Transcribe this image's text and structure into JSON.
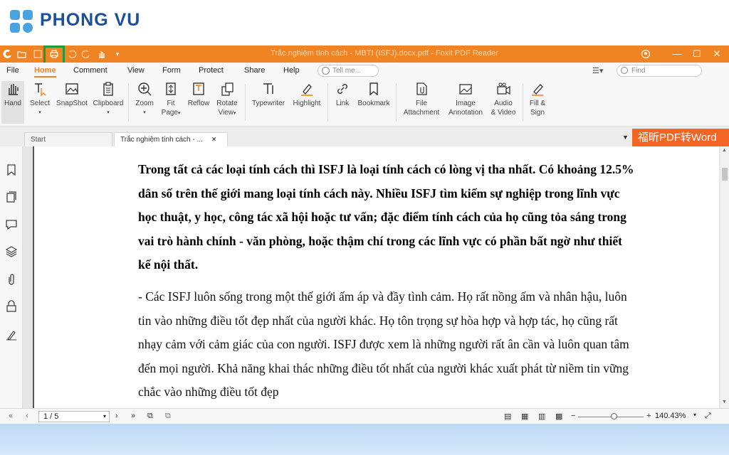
{
  "brand": {
    "name": "PHONG VU",
    "color": "#1b4f9c"
  },
  "window": {
    "title": "Trắc nghiệm tính cách - MBTI (ISFJ).docx.pdf - Foxit PDF Reader",
    "accent": "#f08322"
  },
  "quick_access": [
    "foxit-logo-icon",
    "open-icon",
    "save-icon",
    "print-icon",
    "undo-icon",
    "redo-icon",
    "hand-tool-icon",
    "customize-icon"
  ],
  "menu": {
    "items": [
      "File",
      "Home",
      "Comment",
      "View",
      "Form",
      "Protect",
      "Share",
      "Help"
    ],
    "active": "Home",
    "tell_me": "Tell me...",
    "find": "Find"
  },
  "ribbon": {
    "hand": "Hand",
    "select": "Select",
    "snapshot": "SnapShot",
    "clipboard": "Clipboard",
    "zoom": "Zoom",
    "fit_page_1": "Fit",
    "fit_page_2": "Page",
    "reflow": "Reflow",
    "rotate_view_1": "Rotate",
    "rotate_view_2": "View",
    "typewriter": "Typewriter",
    "highlight": "Highlight",
    "link": "Link",
    "bookmark": "Bookmark",
    "file_attachment_1": "File",
    "file_attachment_2": "Attachment",
    "image_annotation_1": "Image",
    "image_annotation_2": "Annotation",
    "audio_video_1": "Audio",
    "audio_video_2": "& Video",
    "fill_sign_1": "Fill &",
    "fill_sign_2": "Sign"
  },
  "tabs": {
    "start": "Start",
    "document": "Trắc nghiệm tính cách - ...",
    "close": "×"
  },
  "promo": "福昕PDF转Word",
  "document": {
    "bold_paragraph": "Trong tất cả các loại tính cách thì ISFJ là loại tính cách có lòng vị tha nhất. Có khoảng 12.5% dân số trên thế giới mang loại tính cách này. Nhiều ISFJ tìm kiếm sự nghiệp trong lĩnh vực học thuật, y học, công tác xã hội hoặc tư vấn; đặc điểm tính cách của họ cũng tỏa sáng trong vai trò hành chính - văn phòng, hoặc thậm chí trong các lĩnh vực có phần bất ngờ như thiết kế nội thất.",
    "paragraph": "- Các ISFJ luôn sống trong một thế giới ấm áp và đầy tình cảm. Họ rất nồng ấm và nhân hậu, luôn tin vào những điều tốt đẹp nhất của người khác. Họ tôn trọng sự hòa hợp và hợp tác, họ cũng rất nhạy cảm với cảm giác của con người. ISFJ được xem là những người rất ân cần và luôn quan tâm đến mọi người. Khả năng khai thác những điều tốt nhất của người khác xuất phát từ niềm tin vững chắc vào những điều tốt đẹp"
  },
  "status": {
    "page": "1 / 5",
    "zoom": "140.43%",
    "zoom_level_fraction": 0.55
  }
}
